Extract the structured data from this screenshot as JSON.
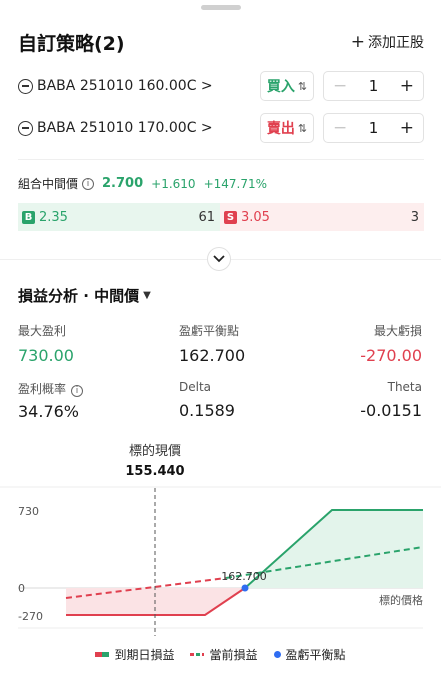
{
  "header": {
    "title": "自訂策略(2)",
    "add_leg": "添加正股"
  },
  "legs": [
    {
      "contract": "BABA 251010 160.00C",
      "side": "買入",
      "qty": "1"
    },
    {
      "contract": "BABA 251010 170.00C",
      "side": "賣出",
      "qty": "1"
    }
  ],
  "combo": {
    "label": "組合中間價",
    "price": "2.700",
    "change": "+1.610",
    "change_pct": "+147.71%"
  },
  "quote": {
    "bid_tag": "B",
    "bid": "2.35",
    "bid_size": "61",
    "ask_tag": "S",
    "ask": "3.05",
    "ask_size": "3"
  },
  "analysis": {
    "title": "損益分析 · 中間價",
    "max_profit_label": "最大盈利",
    "max_profit": "730.00",
    "breakeven_label": "盈虧平衡點",
    "breakeven": "162.700",
    "max_loss_label": "最大虧損",
    "max_loss": "-270.00",
    "prob_label": "盈利概率",
    "prob": "34.76%",
    "delta_label": "Delta",
    "delta": "0.1589",
    "theta_label": "Theta",
    "theta": "-0.0151"
  },
  "chart_labels": {
    "spot_label": "標的現價",
    "spot": "155.440",
    "y_ticks": [
      "730",
      "0",
      "-270"
    ],
    "breakeven": "162.700",
    "x_label": "標的價格"
  },
  "chart_data": {
    "type": "line",
    "spot": 155.44,
    "breakeven": 162.7,
    "x_axis_label": "標的價格",
    "y_ticks": [
      730,
      0,
      -270
    ],
    "series": [
      {
        "name": "到期日損益",
        "x": [
          140,
          160,
          170,
          190
        ],
        "y": [
          -270,
          -270,
          730,
          730
        ]
      },
      {
        "name": "當前損益",
        "x": [
          140,
          190
        ],
        "y": [
          -150,
          350
        ]
      }
    ],
    "points": [
      {
        "name": "盈虧平衡點",
        "x": 162.7,
        "y": 0
      }
    ]
  },
  "legend": [
    "到期日損益",
    "當前損益",
    "盈虧平衡點"
  ],
  "colors": {
    "profit": "#2aa36b",
    "loss": "#e0404f",
    "breakeven": "#2f6df2"
  }
}
